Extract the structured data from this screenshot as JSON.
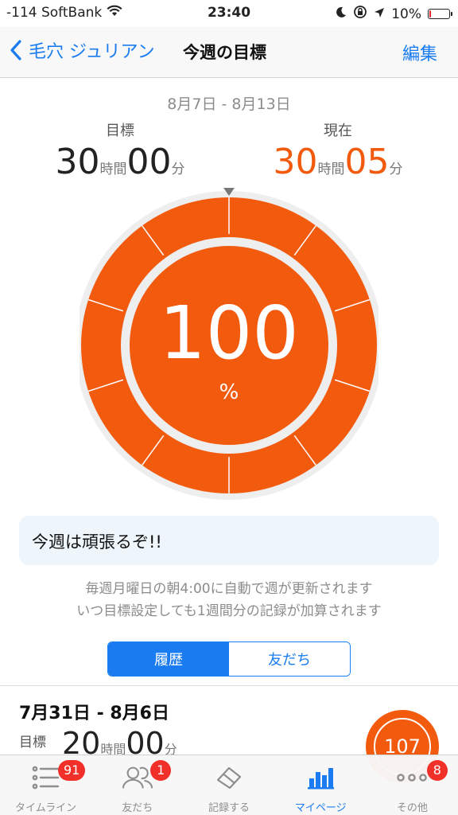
{
  "status_bar": {
    "carrier": "-114 SoftBank",
    "time": "23:40",
    "battery": "10%",
    "battery_level": 0.1,
    "icons": [
      "wifi-icon",
      "moon-icon",
      "rotation-lock-icon",
      "location-arrow-icon",
      "battery-icon"
    ]
  },
  "nav": {
    "back_label": "毛穴 ジュリアン",
    "title": "今週の目標",
    "edit_label": "編集"
  },
  "week": {
    "range": "8月7日 - 8月13日",
    "target": {
      "caption": "目標",
      "hours": "30",
      "hours_unit": "時間",
      "minutes": "00",
      "minutes_unit": "分"
    },
    "current": {
      "caption": "現在",
      "hours": "30",
      "hours_unit": "時間",
      "minutes": "05",
      "minutes_unit": "分"
    },
    "percent": "100",
    "percent_unit": "%",
    "progress": 1.0,
    "segments": 10
  },
  "memo": "今週は頑張るぞ!!",
  "note": {
    "line1": "毎週月曜日の朝4:00に自動で週が更新されます",
    "line2": "いつ目標設定しても1週間分の記録が加算されます"
  },
  "segmented": {
    "history_label": "履歴",
    "friends_label": "友だち",
    "selected": "history"
  },
  "history": [
    {
      "range": "7月31日 - 8月6日",
      "caption": "目標",
      "hours": "20",
      "hours_unit": "時間",
      "minutes": "00",
      "minutes_unit": "分",
      "percent": "107"
    }
  ],
  "tabs": [
    {
      "label": "タイムライン",
      "icon": "timeline-list-icon",
      "badge": "91"
    },
    {
      "label": "友だち",
      "icon": "friends-icon",
      "badge": "1"
    },
    {
      "label": "記録する",
      "icon": "record-eraser-icon",
      "badge": ""
    },
    {
      "label": "マイページ",
      "icon": "mypage-chart-icon",
      "badge": "",
      "active": true
    },
    {
      "label": "その他",
      "icon": "more-dots-icon",
      "badge": "8"
    }
  ],
  "colors": {
    "accent_orange": "#f25a0e",
    "ios_blue": "#1a7cf0",
    "badge_red": "#f2302a"
  }
}
